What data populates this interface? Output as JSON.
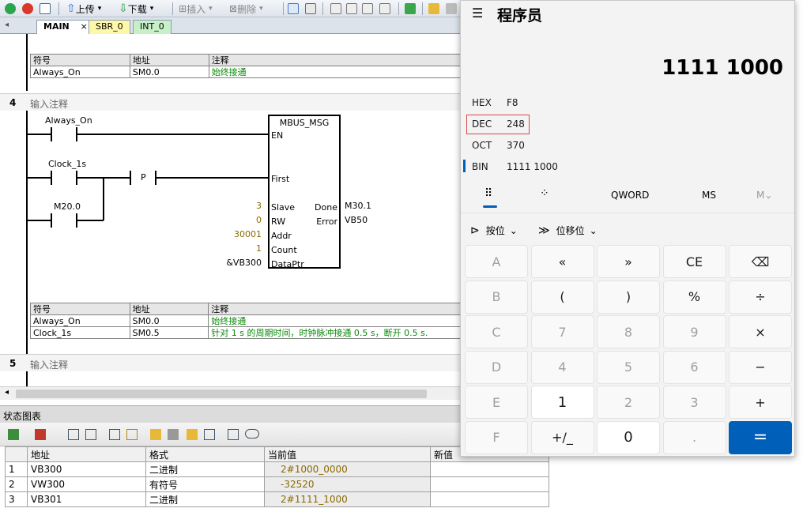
{
  "toolbar": {
    "upload_label": "上传",
    "download_label": "下载",
    "insert_label": "插入",
    "delete_label": "删除"
  },
  "tabs": [
    {
      "label": "MAIN",
      "close": "×",
      "color": "#ffffff"
    },
    {
      "label": "SBR_0",
      "color": "#fff7a8"
    },
    {
      "label": "INT_0",
      "color": "#c8f0c8"
    }
  ],
  "network3": {
    "symbol_table": {
      "headers": [
        "符号",
        "地址",
        "注释"
      ],
      "rows": [
        [
          "Always_On",
          "SM0.0",
          "始终接通"
        ]
      ]
    }
  },
  "network4": {
    "number": "4",
    "comment": "输入注释",
    "contact1": "Always_On",
    "contact2": "Clock_1s",
    "contact3": "M20.0",
    "p_contact": "P",
    "block": {
      "title": "MBUS_MSG",
      "pins_in": [
        "EN",
        "First",
        "Slave",
        "RW",
        "Addr",
        "Count",
        "DataPtr"
      ],
      "vals_in": [
        "3",
        "0",
        "30001",
        "1",
        "&VB300"
      ],
      "pins_out": [
        "Done",
        "Error"
      ],
      "vals_out": [
        "M30.1",
        "VB50"
      ]
    },
    "symbol_table": {
      "headers": [
        "符号",
        "地址",
        "注释"
      ],
      "rows": [
        [
          "Always_On",
          "SM0.0",
          "始终接通"
        ],
        [
          "Clock_1s",
          "SM0.5",
          "针对 1 s 的周期时间，时钟脉冲接通 0.5 s，断开 0.5 s."
        ]
      ]
    }
  },
  "network5": {
    "number": "5",
    "comment": "输入注释"
  },
  "status_chart": {
    "title": "状态图表",
    "headers": [
      "",
      "地址",
      "格式",
      "当前值",
      "新值"
    ],
    "rows": [
      [
        "1",
        "VB300",
        "二进制",
        "2#1000_0000",
        ""
      ],
      [
        "2",
        "VW300",
        "有符号",
        "-32520",
        ""
      ],
      [
        "3",
        "VB301",
        "二进制",
        "2#1111_1000",
        ""
      ]
    ]
  },
  "calculator": {
    "menu_icon": "☰",
    "title": "程序员",
    "display": "1111 1000",
    "radix": [
      {
        "name": "HEX",
        "value": "F8"
      },
      {
        "name": "DEC",
        "value": "248"
      },
      {
        "name": "OCT",
        "value": "370"
      },
      {
        "name": "BIN",
        "value": "1111 1000"
      }
    ],
    "word_size": "QWORD",
    "ms": "MS",
    "m_dropdown": "M",
    "bitwise_label": "按位",
    "bitshift_label": "位移位",
    "accent": "#005fb8",
    "keys": [
      [
        "A",
        "«",
        "»",
        "CE",
        "⌫"
      ],
      [
        "B",
        "(",
        ")",
        "%",
        "÷"
      ],
      [
        "C",
        "7",
        "8",
        "9",
        "×"
      ],
      [
        "D",
        "4",
        "5",
        "6",
        "−"
      ],
      [
        "E",
        "1",
        "2",
        "3",
        "+"
      ],
      [
        "F",
        "+/_",
        "0",
        ".",
        "="
      ]
    ]
  }
}
